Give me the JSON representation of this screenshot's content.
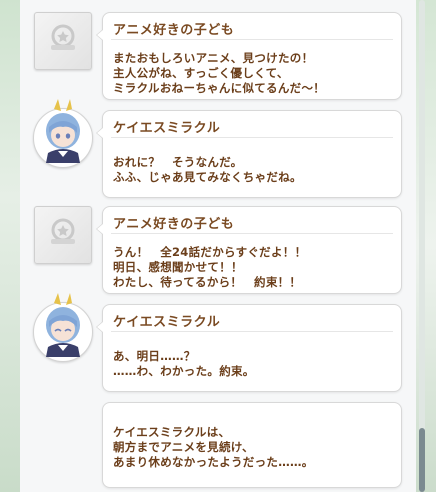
{
  "messages": [
    {
      "speaker": "アニメ好きの子ども",
      "avatar": "placeholder-icon",
      "lines": [
        "またおもしろいアニメ、見つけたの！",
        "主人公がね、すっごく優しくて、",
        "ミラクルおねーちゃんに似てるんだ～！"
      ]
    },
    {
      "speaker": "ケイエスミラクル",
      "avatar": "character-portrait",
      "lines": [
        "おれに？　そうなんだ。",
        "ふふ、じゃあ見てみなくちゃだね。"
      ]
    },
    {
      "speaker": "アニメ好きの子ども",
      "avatar": "placeholder-icon",
      "lines": [
        "うん！　全24話だからすぐだよ！！",
        "明日、感想聞かせて！！",
        "わたし、待ってるから！　約束！！"
      ]
    },
    {
      "speaker": "ケイエスミラクル",
      "avatar": "character-portrait",
      "lines": [
        "あ、明日……？",
        "……わ、わかった。約束。"
      ]
    },
    {
      "speaker": "",
      "avatar": "",
      "lines": [
        "ケイエスミラクルは、",
        "朝方までアニメを見続け、",
        "あまり休めなかったようだった……。"
      ]
    }
  ],
  "colors": {
    "speaker_text": "#7a4a22",
    "message_text": "#6b3e1a",
    "panel_bg": "#f6f7f8"
  }
}
